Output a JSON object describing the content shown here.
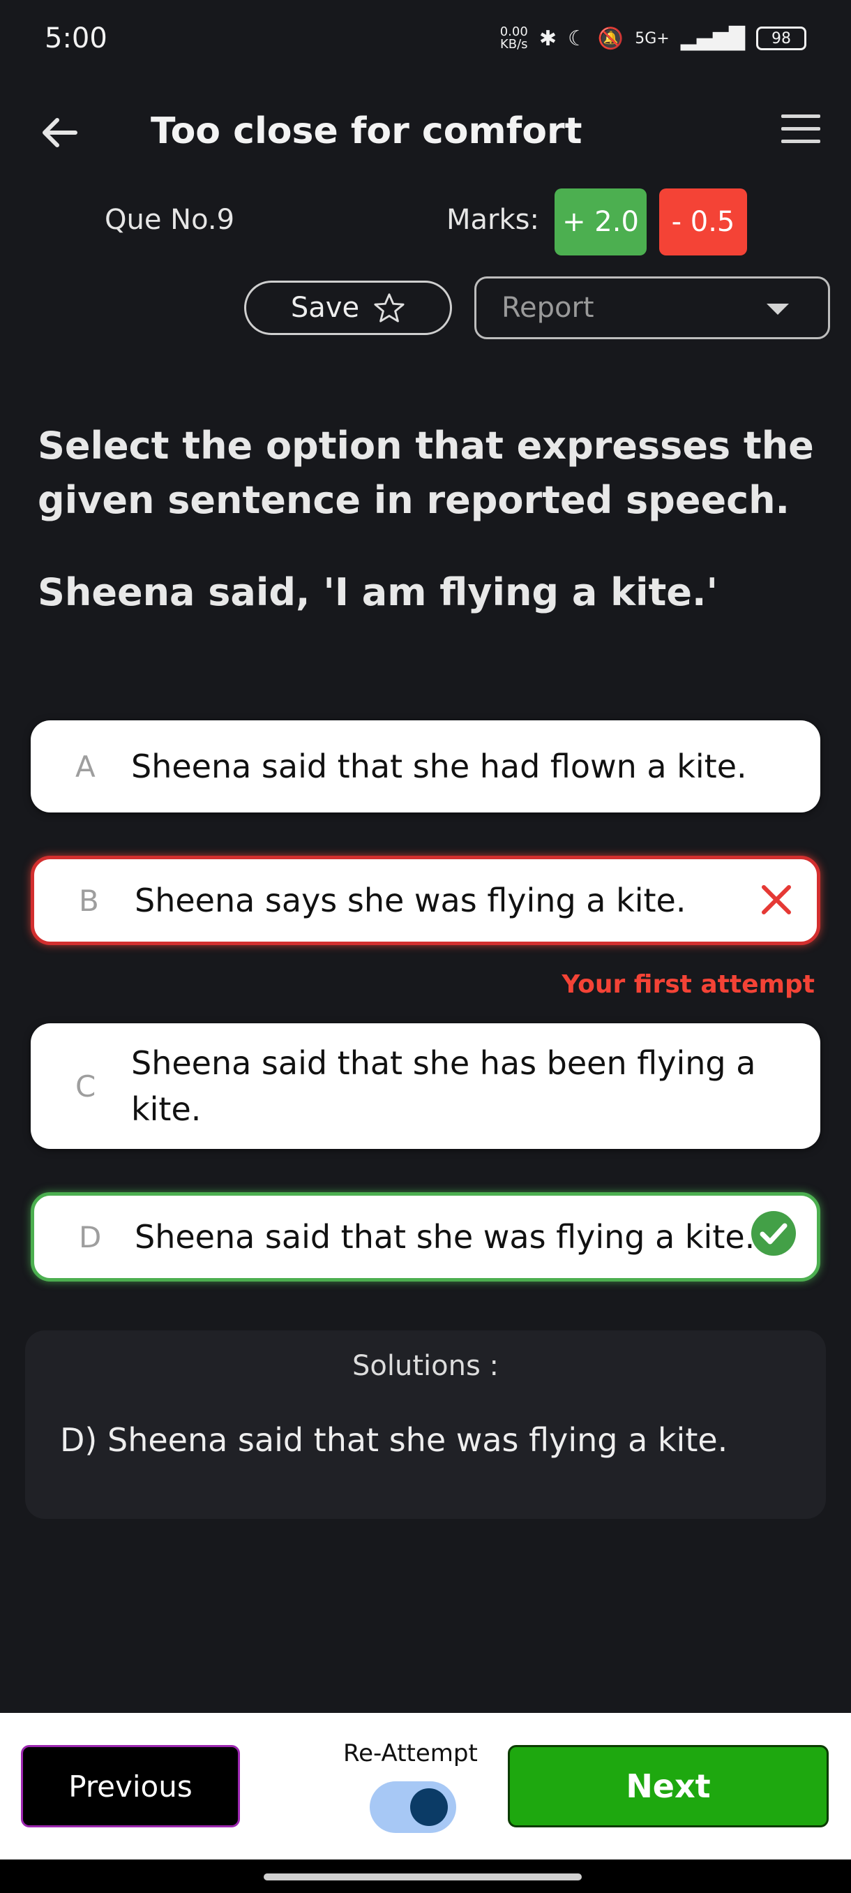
{
  "status_bar": {
    "time": "5:00",
    "net_speed": "0.00",
    "net_unit": "KB/s",
    "network": "5G+",
    "battery": "98",
    "icons": [
      "bluetooth-icon",
      "moon-icon",
      "mute-icon",
      "volte-icon",
      "signal-icon",
      "battery-icon"
    ]
  },
  "header": {
    "title": "Too close for comfort"
  },
  "question_meta": {
    "que_no": "Que No.9",
    "marks_label": "Marks:",
    "positive": "+ 2.0",
    "negative": "- 0.5",
    "save_label": "Save",
    "report_label": "Report"
  },
  "question": {
    "text": "Select the option that expresses the given sentence in reported speech.",
    "sentence": "Sheena said, 'I am flying a kite.'"
  },
  "options": [
    {
      "letter": "A",
      "text": "Sheena said that she had flown a kite."
    },
    {
      "letter": "B",
      "text": "Sheena says she was flying a kite."
    },
    {
      "letter": "C",
      "text": "Sheena said that she has been flying a kite."
    },
    {
      "letter": "D",
      "text": "Sheena said that she was flying a kite."
    }
  ],
  "first_attempt_note": "Your first attempt",
  "solutions": {
    "title": "Solutions :",
    "text": "D) Sheena said that she was flying a kite."
  },
  "footer": {
    "previous_label": "Previous",
    "reattempt_label": "Re-Attempt",
    "next_label": "Next"
  },
  "colors": {
    "background": "#17181c",
    "correct": "#4caf50",
    "wrong": "#f44336",
    "next_button": "#1ea80f"
  }
}
